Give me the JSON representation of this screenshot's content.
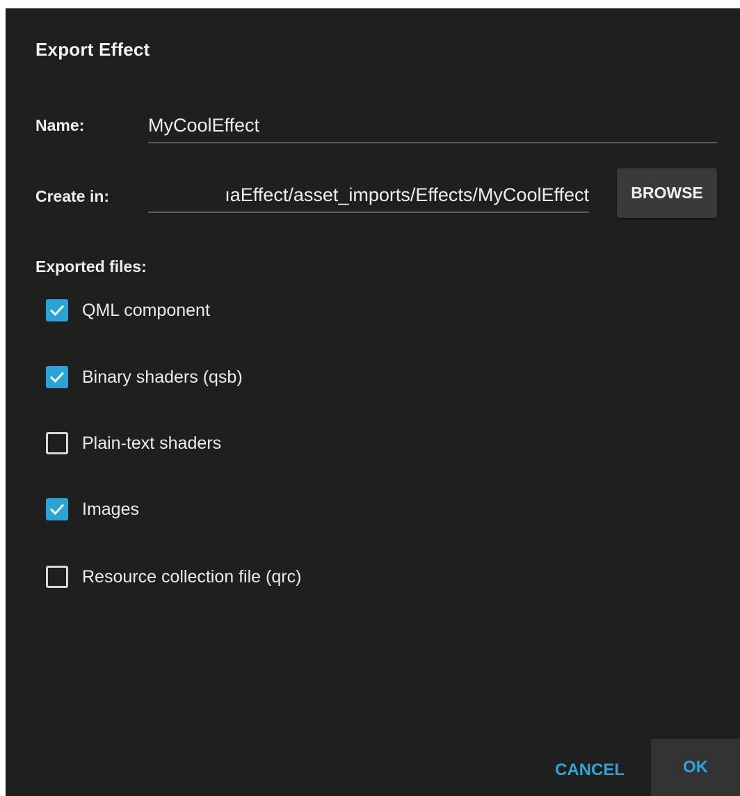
{
  "dialog": {
    "title": "Export Effect"
  },
  "name_field": {
    "label": "Name:",
    "value": "MyCoolEffect"
  },
  "create_in_field": {
    "label": "Create in:",
    "value": "ıaEffect/asset_imports/Effects/MyCoolEffect"
  },
  "browse": {
    "label": "BROWSE"
  },
  "exported_files": {
    "label": "Exported files:",
    "items": [
      {
        "label": "QML component",
        "checked": true
      },
      {
        "label": "Binary shaders (qsb)",
        "checked": true
      },
      {
        "label": "Plain-text shaders",
        "checked": false
      },
      {
        "label": "Images",
        "checked": true
      },
      {
        "label": "Resource collection file (qrc)",
        "checked": false
      }
    ]
  },
  "buttons": {
    "cancel": "CANCEL",
    "ok": "OK"
  },
  "colors": {
    "background": "#1f1f1f",
    "accent": "#29a4d6",
    "button_bg": "#3a3a3a"
  }
}
